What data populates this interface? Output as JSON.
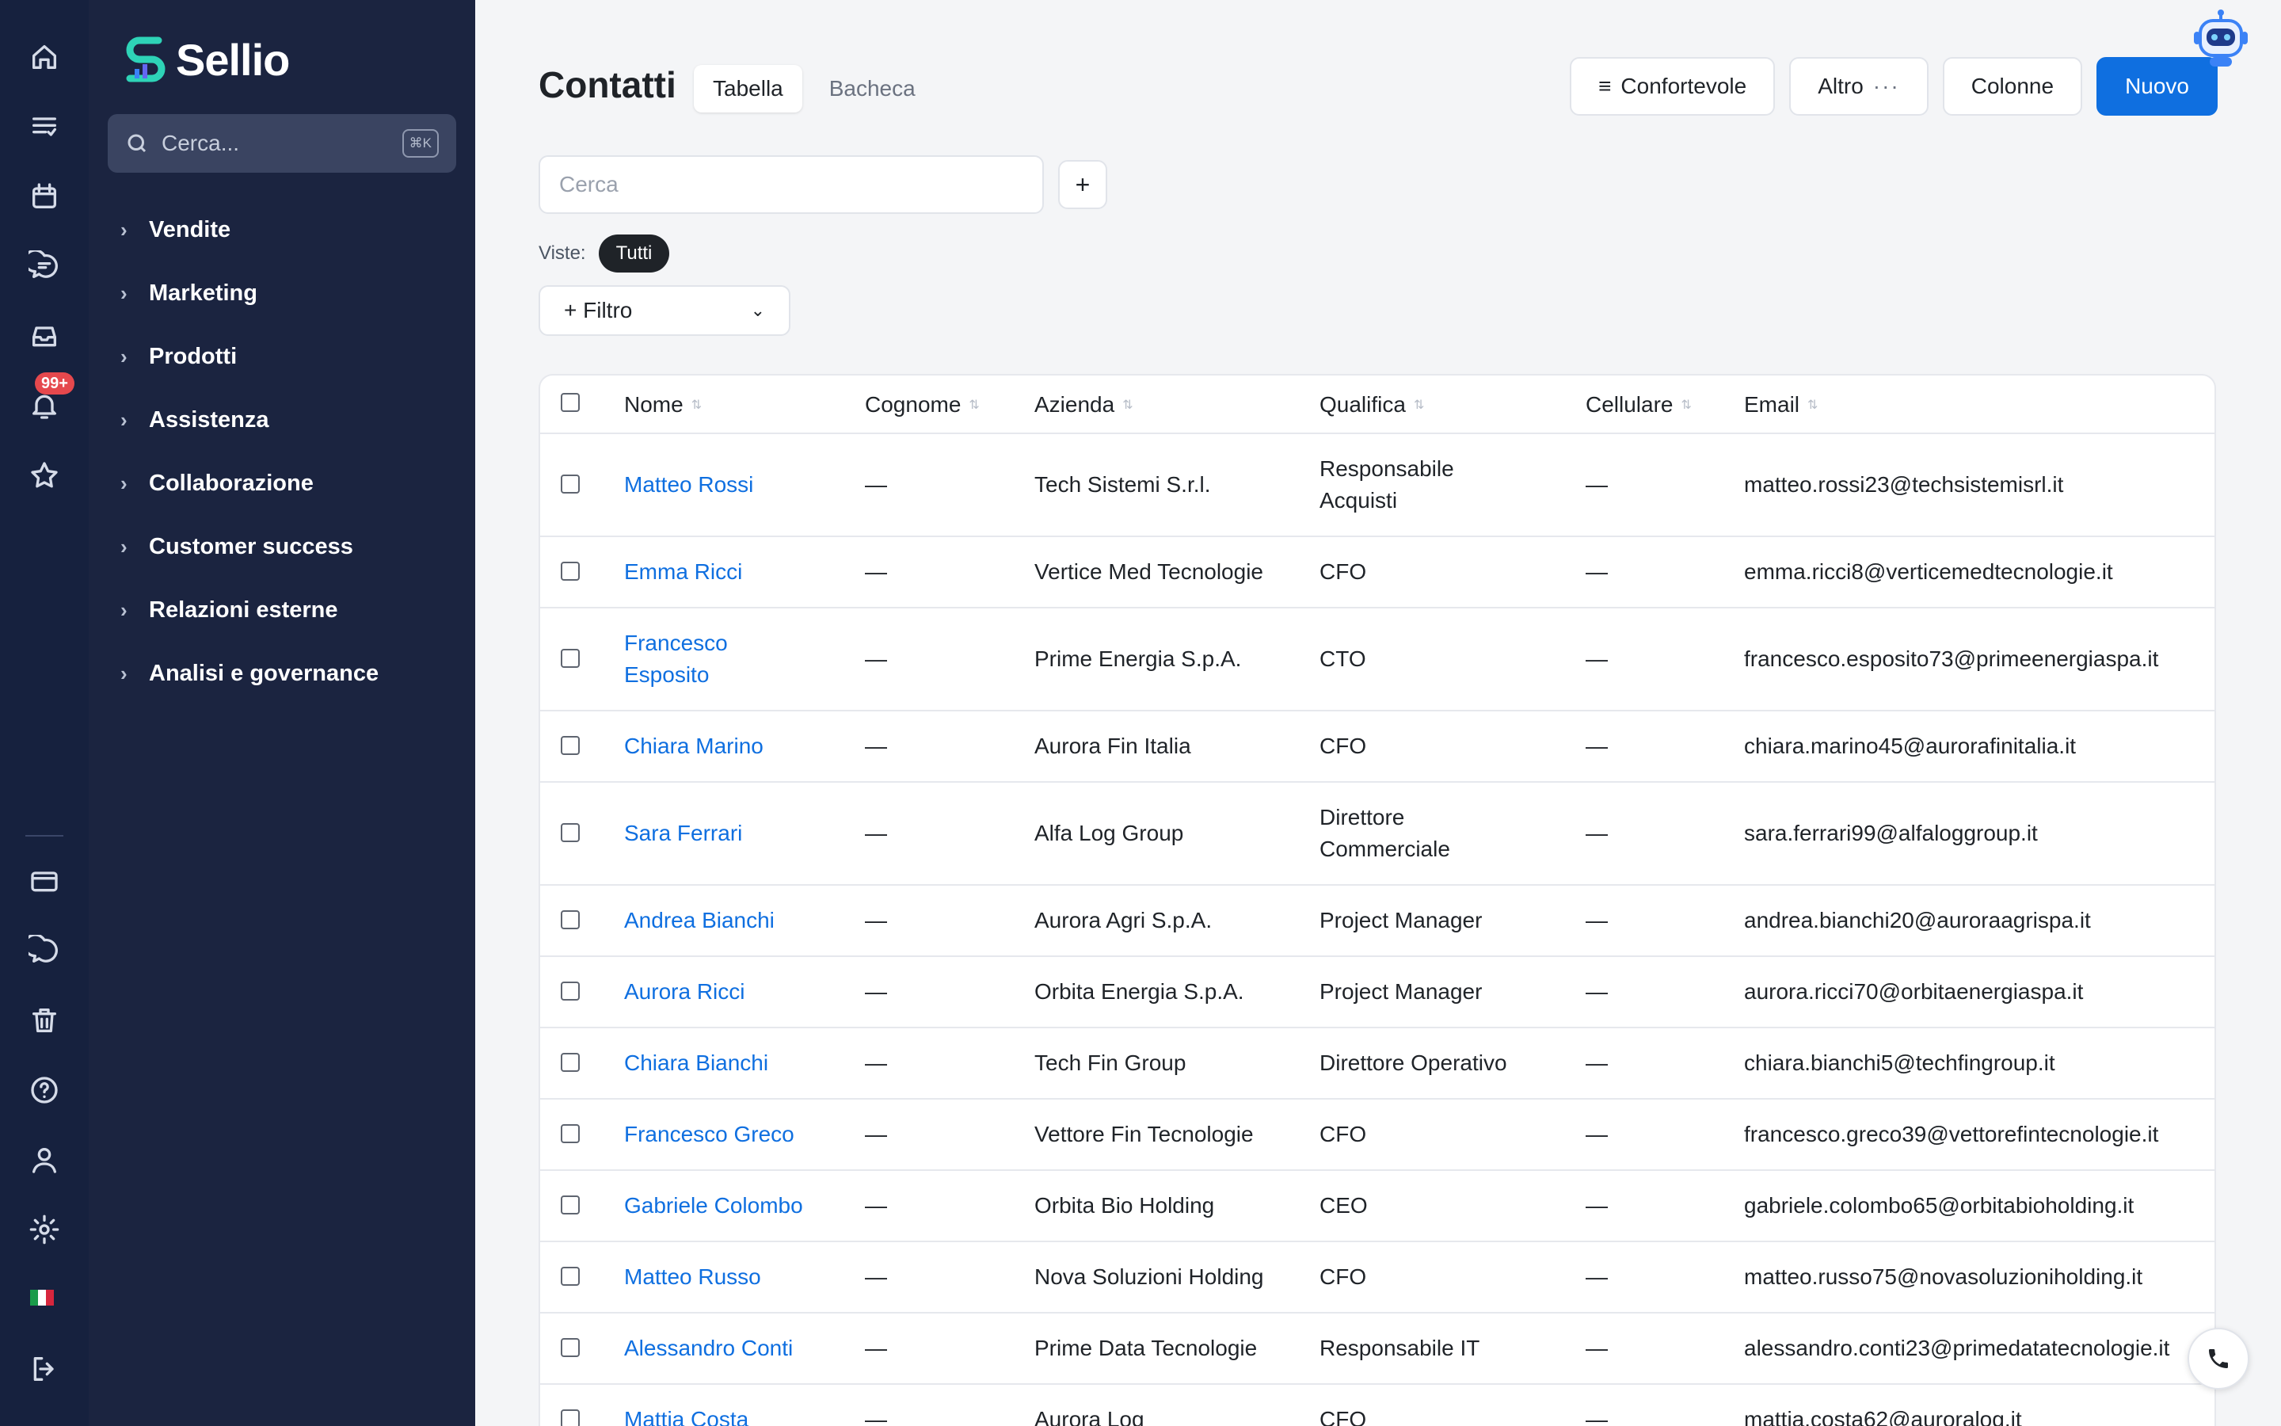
{
  "app": {
    "name": "Sellio",
    "search_placeholder": "Cerca...",
    "search_shortcut": "⌘K",
    "notification_count": "99+",
    "accent": "#0f6fe0"
  },
  "rail": {
    "icons": [
      "home-icon",
      "list-icon",
      "calendar-icon",
      "chat-icon",
      "inbox-icon",
      "bell-icon",
      "star-icon",
      "card-icon",
      "message-icon",
      "trash-icon",
      "help-icon",
      "user-icon",
      "settings-icon",
      "flag-it-icon",
      "logout-icon"
    ]
  },
  "sidebar": {
    "items": [
      {
        "label": "Vendite"
      },
      {
        "label": "Marketing"
      },
      {
        "label": "Prodotti"
      },
      {
        "label": "Assistenza"
      },
      {
        "label": "Collaborazione"
      },
      {
        "label": "Customer success"
      },
      {
        "label": "Relazioni esterne"
      },
      {
        "label": "Analisi e governance"
      }
    ]
  },
  "header": {
    "title": "Contatti",
    "tabs": [
      {
        "label": "Tabella",
        "active": true
      },
      {
        "label": "Bacheca",
        "active": false
      }
    ],
    "density_label": "Confortevole",
    "more_label": "Altro",
    "columns_label": "Colonne",
    "new_label": "Nuovo"
  },
  "toolbar": {
    "search_placeholder": "Cerca",
    "views_label": "Viste:",
    "views_active": "Tutti",
    "filter_label": "+ Filtro"
  },
  "table": {
    "columns": [
      "Nome",
      "Cognome",
      "Azienda",
      "Qualifica",
      "Cellulare",
      "Email"
    ],
    "rows": [
      {
        "nome": "Matteo Rossi",
        "cognome": "—",
        "azienda": "Tech Sistemi S.r.l.",
        "qualifica": "Responsabile Acquisti",
        "cellulare": "—",
        "email": "matteo.rossi23@techsistemisrl.it"
      },
      {
        "nome": "Emma Ricci",
        "cognome": "—",
        "azienda": "Vertice Med Tecnologie",
        "qualifica": "CFO",
        "cellulare": "—",
        "email": "emma.ricci8@verticemedtecnologie.it"
      },
      {
        "nome": "Francesco Esposito",
        "cognome": "—",
        "azienda": "Prime Energia S.p.A.",
        "qualifica": "CTO",
        "cellulare": "—",
        "email": "francesco.esposito73@primeenergiaspa.it"
      },
      {
        "nome": "Chiara Marino",
        "cognome": "—",
        "azienda": "Aurora Fin Italia",
        "qualifica": "CFO",
        "cellulare": "—",
        "email": "chiara.marino45@aurorafinitalia.it"
      },
      {
        "nome": "Sara Ferrari",
        "cognome": "—",
        "azienda": "Alfa Log Group",
        "qualifica": "Direttore Commerciale",
        "cellulare": "—",
        "email": "sara.ferrari99@alfaloggroup.it"
      },
      {
        "nome": "Andrea Bianchi",
        "cognome": "—",
        "azienda": "Aurora Agri S.p.A.",
        "qualifica": "Project Manager",
        "cellulare": "—",
        "email": "andrea.bianchi20@auroraagrispa.it"
      },
      {
        "nome": "Aurora Ricci",
        "cognome": "—",
        "azienda": "Orbita Energia S.p.A.",
        "qualifica": "Project Manager",
        "cellulare": "—",
        "email": "aurora.ricci70@orbitaenergiaspa.it"
      },
      {
        "nome": "Chiara Bianchi",
        "cognome": "—",
        "azienda": "Tech Fin Group",
        "qualifica": "Direttore Operativo",
        "cellulare": "—",
        "email": "chiara.bianchi5@techfingroup.it"
      },
      {
        "nome": "Francesco Greco",
        "cognome": "—",
        "azienda": "Vettore Fin Tecnologie",
        "qualifica": "CFO",
        "cellulare": "—",
        "email": "francesco.greco39@vettorefintecnologie.it"
      },
      {
        "nome": "Gabriele Colombo",
        "cognome": "—",
        "azienda": "Orbita Bio Holding",
        "qualifica": "CEO",
        "cellulare": "—",
        "email": "gabriele.colombo65@orbitabioholding.it"
      },
      {
        "nome": "Matteo Russo",
        "cognome": "—",
        "azienda": "Nova Soluzioni Holding",
        "qualifica": "CFO",
        "cellulare": "—",
        "email": "matteo.russo75@novasoluzioniholding.it"
      },
      {
        "nome": "Alessandro Conti",
        "cognome": "—",
        "azienda": "Prime Data Tecnologie",
        "qualifica": "Responsabile IT",
        "cellulare": "—",
        "email": "alessandro.conti23@primedatatecnologie.it"
      },
      {
        "nome": "Mattia Costa",
        "cognome": "—",
        "azienda": "Aurora Log",
        "qualifica": "CFO",
        "cellulare": "—",
        "email": "mattia.costa62@auroralog.it"
      }
    ]
  }
}
